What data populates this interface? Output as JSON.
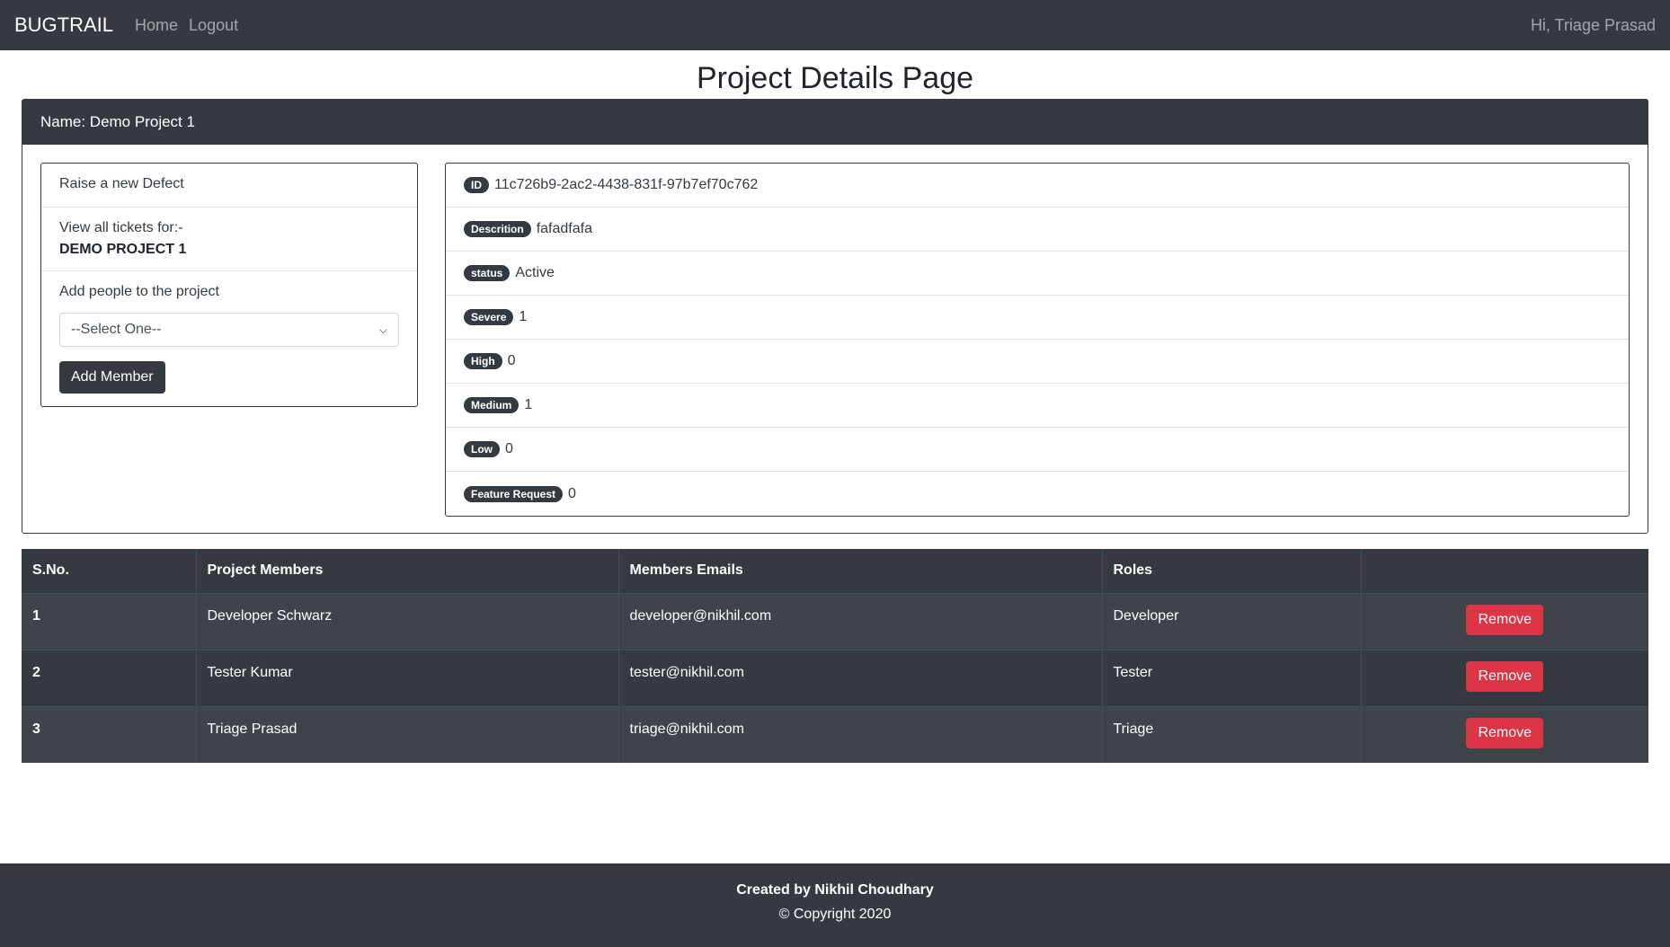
{
  "navbar": {
    "brand": "BUGTRAIL",
    "links": [
      "Home",
      "Logout"
    ],
    "greeting": "Hi, Triage Prasad"
  },
  "page_title": "Project Details Page",
  "project": {
    "header": "Name: Demo Project 1",
    "actions": {
      "raise_defect": "Raise a new Defect",
      "view_tickets_label": "View all tickets for:-",
      "project_name_caps": "DEMO PROJECT 1",
      "add_people_label": "Add people to the project",
      "select_value": "--Select One--",
      "add_member_button": "Add Member"
    },
    "details": [
      {
        "badge": "ID",
        "value": "11c726b9-2ac2-4438-831f-97b7ef70c762"
      },
      {
        "badge": "Descrition",
        "value": "fafadfafa"
      },
      {
        "badge": "status",
        "value": "Active"
      },
      {
        "badge": "Severe",
        "value": "1"
      },
      {
        "badge": "High",
        "value": "0"
      },
      {
        "badge": "Medium",
        "value": "1"
      },
      {
        "badge": "Low",
        "value": "0"
      },
      {
        "badge": "Feature Request",
        "value": "0"
      }
    ]
  },
  "members_table": {
    "headers": [
      "S.No.",
      "Project Members",
      "Members Emails",
      "Roles",
      ""
    ],
    "rows": [
      {
        "sn": "1",
        "name": "Developer Schwarz",
        "email": "developer@nikhil.com",
        "role": "Developer",
        "action": "Remove"
      },
      {
        "sn": "2",
        "name": "Tester Kumar",
        "email": "tester@nikhil.com",
        "role": "Tester",
        "action": "Remove"
      },
      {
        "sn": "3",
        "name": "Triage Prasad",
        "email": "triage@nikhil.com",
        "role": "Triage",
        "action": "Remove"
      }
    ]
  },
  "footer": {
    "created_by": "Created by Nikhil Choudhary",
    "copyright": "© Copyright 2020"
  },
  "colors": {
    "dark": "#343a40",
    "danger": "#dc3545"
  }
}
